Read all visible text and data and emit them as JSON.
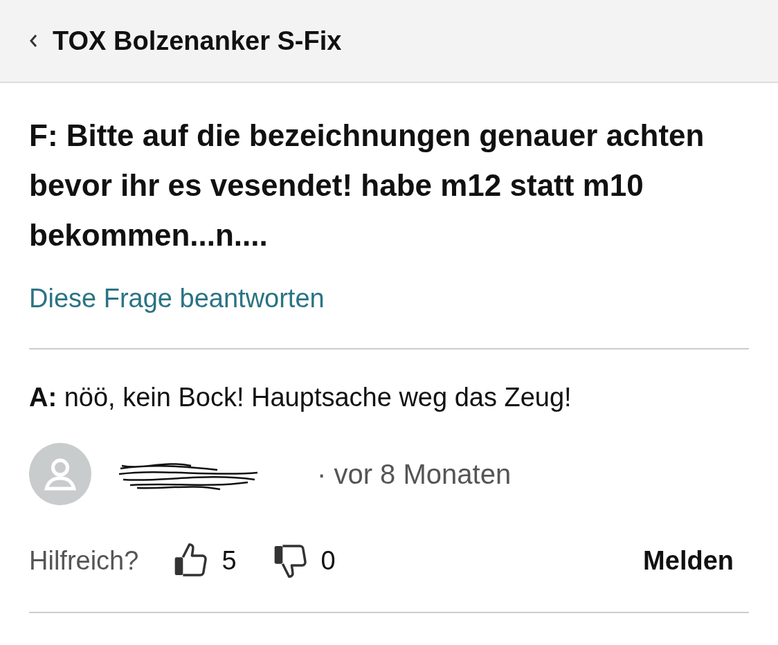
{
  "header": {
    "title": "TOX Bolzenanker S-Fix"
  },
  "question": {
    "text": "F: Bitte auf die bezeichnungen genauer achten bevor ihr es vesendet! habe m12 statt m10 bekommen...n....",
    "answer_link": "Diese Frage beantworten"
  },
  "answer": {
    "text": "**A:** nöö, kein Bock! Hauptsache weg das Zeug!",
    "time": "· vor 8 Monaten"
  },
  "votes": {
    "label": "Hilfreich?",
    "up_count": "5",
    "down_count": "0",
    "report": "Melden"
  }
}
